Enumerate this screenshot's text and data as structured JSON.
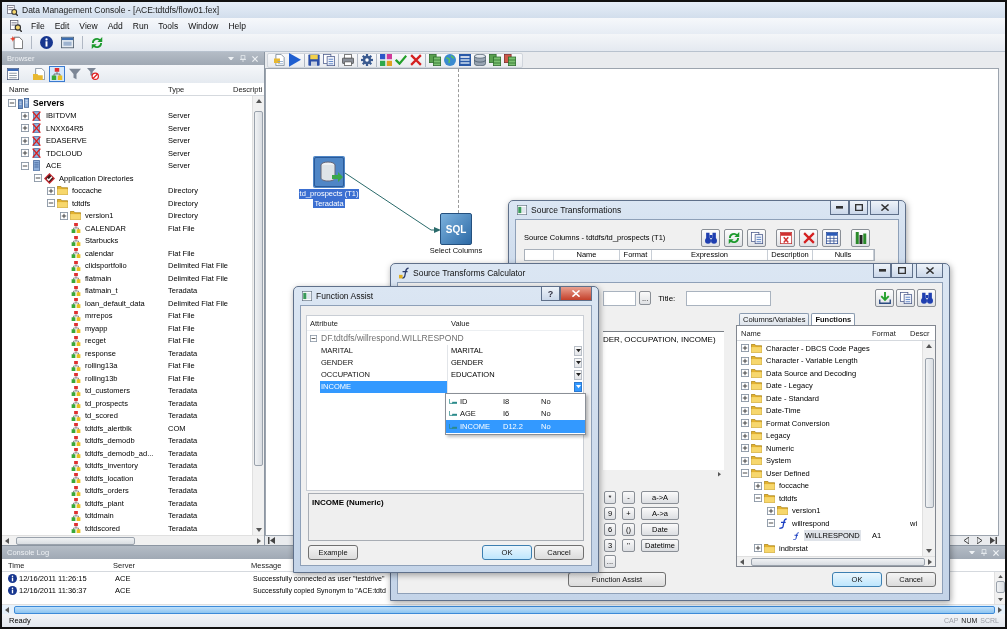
{
  "window": {
    "title": "Data Management Console - [ACE:tdtdfs/flow01.fex]"
  },
  "menu": [
    "File",
    "Edit",
    "View",
    "Add",
    "Run",
    "Tools",
    "Window",
    "Help"
  ],
  "browser": {
    "title": "Browser",
    "tools": [
      {
        "kind": "table-list",
        "pressed": false
      },
      {
        "kind": "folder-document",
        "pressed": false
      },
      {
        "kind": "hierarchy",
        "pressed": true
      },
      {
        "kind": "filter",
        "pressed": false
      },
      {
        "kind": "filter-clear",
        "pressed": false
      }
    ],
    "columns": [
      "Name",
      "Type",
      "Descripti"
    ],
    "tree": [
      {
        "name": "Servers",
        "kind": "servers",
        "expanded": true,
        "children": [
          {
            "name": "IBITDVM",
            "type": "Server",
            "kind": "server-error",
            "expanded": false
          },
          {
            "name": "LNXX64R5",
            "type": "Server",
            "kind": "server-error",
            "expanded": false
          },
          {
            "name": "EDASERVE",
            "type": "Server",
            "kind": "server-error",
            "expanded": false
          },
          {
            "name": "TDCLOUD",
            "type": "Server",
            "kind": "server-error",
            "expanded": false
          },
          {
            "name": "ACE",
            "type": "Server",
            "kind": "server",
            "expanded": true,
            "children": [
              {
                "name": "Application Directories",
                "kind": "app-dirs",
                "expanded": true,
                "children": [
                  {
                    "name": "foccache",
                    "type": "Directory",
                    "kind": "folder",
                    "expanded": false
                  },
                  {
                    "name": "tdtdfs",
                    "type": "Directory",
                    "kind": "folder",
                    "expanded": true,
                    "children": [
                      {
                        "name": "version1",
                        "type": "Directory",
                        "kind": "folder",
                        "expanded": false
                      },
                      {
                        "name": "CALENDAR",
                        "type": "Flat File",
                        "kind": "synonym"
                      },
                      {
                        "name": "Starbucks",
                        "kind": "synonym"
                      },
                      {
                        "name": "calendar",
                        "type": "Flat File",
                        "kind": "synonym"
                      },
                      {
                        "name": "clidsportfolio",
                        "type": "Delimited Flat File",
                        "kind": "synonym"
                      },
                      {
                        "name": "flatmain",
                        "type": "Delimited Flat File",
                        "kind": "synonym"
                      },
                      {
                        "name": "flatmain_t",
                        "type": "Teradata",
                        "kind": "synonym"
                      },
                      {
                        "name": "loan_default_data",
                        "type": "Delimited Flat File",
                        "kind": "synonym"
                      },
                      {
                        "name": "mrrepos",
                        "type": "Flat File",
                        "kind": "synonym"
                      },
                      {
                        "name": "myapp",
                        "type": "Flat File",
                        "kind": "synonym"
                      },
                      {
                        "name": "recget",
                        "type": "Flat File",
                        "kind": "synonym"
                      },
                      {
                        "name": "response",
                        "type": "Teradata",
                        "kind": "synonym"
                      },
                      {
                        "name": "rolling13a",
                        "type": "Flat File",
                        "kind": "synonym"
                      },
                      {
                        "name": "rolling13b",
                        "type": "Flat File",
                        "kind": "synonym"
                      },
                      {
                        "name": "td_customers",
                        "type": "Teradata",
                        "kind": "synonym"
                      },
                      {
                        "name": "td_prospects",
                        "type": "Teradata",
                        "kind": "synonym"
                      },
                      {
                        "name": "td_scored",
                        "type": "Teradata",
                        "kind": "synonym"
                      },
                      {
                        "name": "tdtdfs_alertblk",
                        "type": "COM",
                        "kind": "synonym"
                      },
                      {
                        "name": "tdtdfs_demodb",
                        "type": "Teradata",
                        "kind": "synonym"
                      },
                      {
                        "name": "tdtdfs_demodb_ad...",
                        "type": "Teradata",
                        "kind": "synonym"
                      },
                      {
                        "name": "tdtdfs_inventory",
                        "type": "Teradata",
                        "kind": "synonym"
                      },
                      {
                        "name": "tdtdfs_location",
                        "type": "Teradata",
                        "kind": "synonym"
                      },
                      {
                        "name": "tdtdfs_orders",
                        "type": "Teradata",
                        "kind": "synonym"
                      },
                      {
                        "name": "tdtdfs_plant",
                        "type": "Teradata",
                        "kind": "synonym"
                      },
                      {
                        "name": "tdtdmain",
                        "type": "Teradata",
                        "kind": "synonym"
                      },
                      {
                        "name": "tdtdscored",
                        "type": "Teradata",
                        "kind": "synonym"
                      }
                    ]
                  }
                ]
              }
            ]
          }
        ]
      }
    ]
  },
  "flow": {
    "nodes": [
      {
        "kind": "table",
        "label": "td_prospects (T1)",
        "sublabel": "Teradata",
        "selected": true
      },
      {
        "kind": "sql",
        "icon_text": "SQL",
        "label": "Select Columns",
        "selected": false
      }
    ]
  },
  "console": {
    "title": "Console Log",
    "columns": [
      "Time",
      "Server",
      "Message"
    ],
    "rows": [
      {
        "kind": "info",
        "time": "12/16/2011 11:26:15",
        "server": "ACE",
        "message": "Successfully connected as user \"testdrive\""
      },
      {
        "kind": "info",
        "time": "12/16/2011 11:36:37",
        "server": "ACE",
        "message": "Successfully copied Synonym to \"ACE:tdtd"
      }
    ]
  },
  "status_bar": {
    "text": "Ready",
    "indicators": [
      {
        "label": "CAP",
        "on": false
      },
      {
        "label": "NUM",
        "on": true
      },
      {
        "label": "SCRL",
        "on": false
      }
    ]
  },
  "source_transformations": {
    "title": "Source Transformations",
    "subtitle": "Source Columns - tdtdfs/td_prospects (T1)",
    "columns": [
      "Name",
      "Format",
      "Expression",
      "Description",
      "Nulls"
    ]
  },
  "calculator": {
    "title": "Source Transforms Calculator",
    "browse_button": "...",
    "title_label": "Title:",
    "expression": "DER, OCCUPATION, INCOME)",
    "keys": [
      [
        "*",
        "-",
        "a->A"
      ],
      [
        "9",
        "+",
        "A->a"
      ],
      [
        "6",
        "()",
        "Date"
      ],
      [
        "3",
        "''",
        "Datetime"
      ],
      [
        "..."
      ]
    ],
    "tabs": [
      {
        "label": "Columns/Variables",
        "selected": false
      },
      {
        "label": "Functions",
        "selected": true
      }
    ],
    "function_columns": [
      "Name",
      "Format",
      "Descr"
    ],
    "functions": [
      {
        "name": "Character - DBCS Code Pages",
        "kind": "folder",
        "expanded": false,
        "selected": false
      },
      {
        "name": "Character - Variable Length",
        "kind": "folder",
        "expanded": false,
        "selected": false
      },
      {
        "name": "Data Source and Decoding",
        "kind": "folder",
        "expanded": false,
        "selected": false
      },
      {
        "name": "Date - Legacy",
        "kind": "folder",
        "expanded": false,
        "selected": false
      },
      {
        "name": "Date - Standard",
        "kind": "folder",
        "expanded": false,
        "selected": false
      },
      {
        "name": "Date-Time",
        "kind": "folder",
        "expanded": false,
        "selected": false
      },
      {
        "name": "Format Conversion",
        "kind": "folder",
        "expanded": false,
        "selected": false
      },
      {
        "name": "Legacy",
        "kind": "folder",
        "expanded": false,
        "selected": false
      },
      {
        "name": "Numeric",
        "kind": "folder",
        "expanded": false,
        "selected": false
      },
      {
        "name": "System",
        "kind": "folder",
        "expanded": false,
        "selected": false
      },
      {
        "name": "User Defined",
        "kind": "folder",
        "expanded": true,
        "selected": false,
        "children": [
          {
            "name": "foccache",
            "kind": "folder",
            "expanded": false,
            "selected": false
          },
          {
            "name": "tdtdfs",
            "kind": "folder",
            "expanded": true,
            "selected": false,
            "children": [
              {
                "name": "version1",
                "kind": "folder",
                "expanded": false,
                "selected": false
              },
              {
                "name": "willrespond",
                "kind": "function",
                "expanded": true,
                "selected": false,
                "description": "wi",
                "children": [
                  {
                    "name": "WILLRESPOND",
                    "kind": "field",
                    "format": "A1",
                    "selected": true
                  }
                ]
              }
            ]
          },
          {
            "name": "indbrstat",
            "kind": "folder",
            "expanded": false,
            "selected": false
          }
        ]
      }
    ],
    "buttons": [
      "Function Assist",
      "OK",
      "Cancel"
    ]
  },
  "function_assist": {
    "title": "Function Assist",
    "help_button": "?",
    "columns": [
      "Attribute",
      "Value"
    ],
    "group": {
      "label": "DF.tdtdfs/willrespond.WILLRESPOND",
      "expanded": true
    },
    "rows": [
      {
        "attribute": "MARITAL",
        "value": "MARITAL",
        "selected": false,
        "open": false
      },
      {
        "attribute": "GENDER",
        "value": "GENDER",
        "selected": false,
        "open": false
      },
      {
        "attribute": "OCCUPATION",
        "value": "EDUCATION",
        "selected": false,
        "open": false
      },
      {
        "attribute": "INCOME",
        "selected": true,
        "open": true
      }
    ],
    "options": [
      {
        "name": "ID",
        "format": "I8",
        "nulls": "No",
        "selected": false
      },
      {
        "name": "AGE",
        "format": "I6",
        "nulls": "No",
        "selected": false
      },
      {
        "name": "INCOME",
        "format": "D12.2",
        "nulls": "No",
        "selected": true
      }
    ],
    "description": "INCOME (Numeric)",
    "buttons": [
      "Example",
      "OK",
      "Cancel"
    ]
  }
}
